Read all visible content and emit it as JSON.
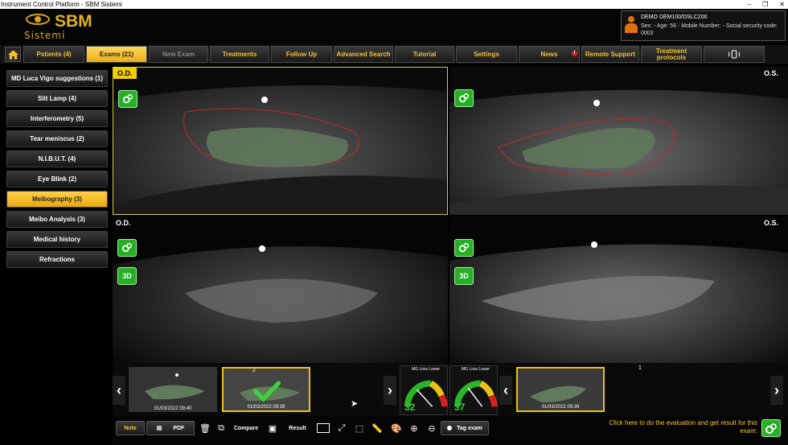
{
  "window": {
    "title": "Instrument Control Platform - SBM Sistemi",
    "controls": [
      "–",
      "❐",
      "✕"
    ]
  },
  "logo": {
    "brand": "SBM",
    "sub": "Sistemi"
  },
  "patient": {
    "name": "DEMO DEM100/DSLC200",
    "info": "Sex:  - Age: 56 - Mobile Number:  - Social security code: 0003"
  },
  "nav": {
    "home_icon": "home-icon",
    "items": [
      {
        "label": "Patients (4)"
      },
      {
        "label": "Exams (21)"
      },
      {
        "label": "New Exam"
      },
      {
        "label": "Treatments"
      },
      {
        "label": "Follow Up"
      },
      {
        "label": "Advanced Search"
      },
      {
        "label": "Tutorial"
      },
      {
        "label": "Settings"
      },
      {
        "label": "News"
      },
      {
        "label": "Remote Support"
      },
      {
        "label": "Treatment protocols"
      }
    ],
    "alert": "!"
  },
  "sidebar": {
    "items": [
      {
        "label": "MD Luca Vigo suggestions (1)"
      },
      {
        "label": "Slit Lamp (4)"
      },
      {
        "label": "Interferometry (5)"
      },
      {
        "label": "Tear meniscus (2)"
      },
      {
        "label": "N.I.B.U.T. (4)"
      },
      {
        "label": "Eye Blink (2)"
      },
      {
        "label": "Meibography (3)"
      },
      {
        "label": "Meibo Analysis (3)"
      },
      {
        "label": "Medical history"
      },
      {
        "label": "Refractions"
      }
    ]
  },
  "panes": {
    "od_top": "O.D.",
    "os_top": "O.S.",
    "od_bottom": "O.D.",
    "os_bottom": "O.S.",
    "btn_3d": "3D"
  },
  "strip": {
    "thumbs": [
      {
        "date": "01/03/2022 09:40"
      },
      {
        "date": "01/03/2022 09:39",
        "index": "2"
      },
      {
        "date": "01/03/2022 09:39",
        "index": "1"
      }
    ],
    "gauges": [
      {
        "title": "MG Loss Lower",
        "value": "32"
      },
      {
        "title": "MG Loss Lower",
        "value": "37"
      }
    ]
  },
  "toolbar": {
    "note": "Note",
    "pdf": "PDF",
    "compare": "Compare",
    "result": "Result",
    "tag": "Tag exam"
  },
  "evaluation": {
    "text": "Click here to do the evaluation and get result for this exam:"
  }
}
